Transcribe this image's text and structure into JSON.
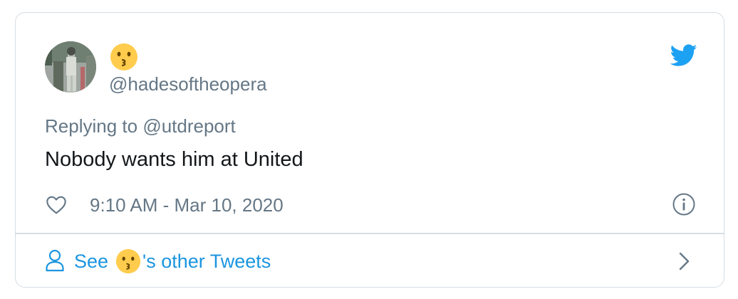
{
  "tweet": {
    "display_name_emoji": "kissing-face-emoji",
    "handle": "@hadesoftheopera",
    "replying_prefix": "Replying to",
    "replying_to": "@utdreport",
    "text": "Nobody wants him at United",
    "timestamp": "9:10 AM - Mar 10, 2020"
  },
  "footer": {
    "see_label": "See",
    "other_tweets_label": "'s other Tweets"
  },
  "icons": {
    "avatar": "avatar",
    "brand": "twitter-bird-icon",
    "like": "heart-icon",
    "info": "info-icon",
    "user": "user-icon",
    "chevron": "chevron-right-icon"
  },
  "colors": {
    "twitter_blue": "#1da1f2",
    "link_blue": "#1b95e0",
    "secondary_text": "#657786",
    "primary_text": "#14171a",
    "border": "#d6dde3",
    "emoji_yellow": "#ffcc4d"
  }
}
